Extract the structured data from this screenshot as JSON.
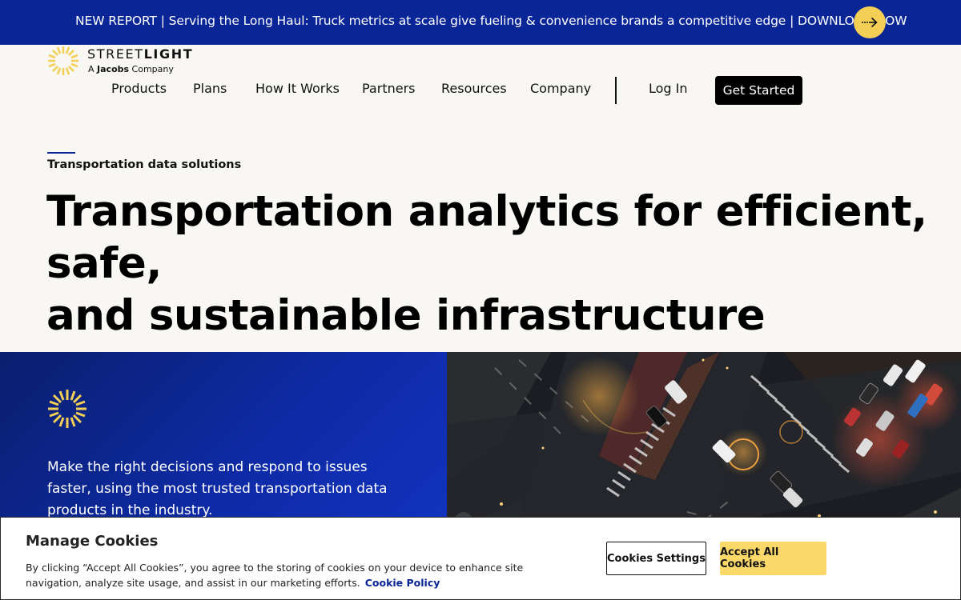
{
  "announcement": {
    "text": "NEW REPORT | Serving the Long Haul: Truck metrics at scale give fueling & convenience brands a competitive edge | DOWNLOAD NOW",
    "button_icon": "arrow-right-icon"
  },
  "logo": {
    "word_light": "STREET",
    "word_bold": "LIGHT",
    "tag_prefix": "A",
    "tag_brand": "Jacobs",
    "tag_suffix": "Company"
  },
  "nav": {
    "items": [
      {
        "label": "Products"
      },
      {
        "label": "Plans"
      },
      {
        "label": "How It Works"
      },
      {
        "label": "Partners"
      },
      {
        "label": "Resources"
      },
      {
        "label": "Company"
      }
    ],
    "login": "Log In",
    "cta": "Get Started"
  },
  "hero": {
    "eyebrow": "Transportation data solutions",
    "title_line1": "Transportation analytics for efficient, safe,",
    "title_line2": "and sustainable infrastructure"
  },
  "feature": {
    "text": "Make the right decisions and respond to issues faster, using the most trusted transportation data products in the industry."
  },
  "cookie": {
    "title": "Manage Cookies",
    "body": "By clicking “Accept All Cookies”, you agree to the storing of cookies on your device to enhance site navigation, analyze site usage, and assist in our marketing efforts.",
    "policy_link": "Cookie Policy",
    "settings_button": "Cookies Settings",
    "accept_button": "Accept All Cookies"
  },
  "colors": {
    "brand_blue": "#0a2596",
    "accent_yellow": "#f3cf55",
    "cookie_yellow": "#fad96a"
  }
}
